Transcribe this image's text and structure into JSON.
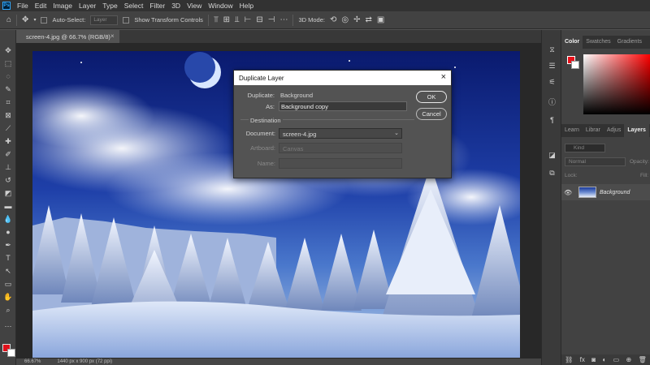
{
  "menubar": {
    "logo": "Ps",
    "items": [
      "File",
      "Edit",
      "Image",
      "Layer",
      "Type",
      "Select",
      "Filter",
      "3D",
      "View",
      "Window",
      "Help"
    ]
  },
  "options": {
    "auto_select": "Auto-Select:",
    "layer_field": "Layer",
    "transform_controls": "Show Transform Controls",
    "mode_3d": "3D Mode:"
  },
  "document": {
    "tab_title": "screen-4.jpg @ 66.7% (RGB/8)",
    "zoom": "66.67%",
    "status_info": "1440 px x 900 px (72 ppi)"
  },
  "panel": {
    "top_tabs": [
      "Color",
      "Swatches",
      "Gradients"
    ],
    "layer_tabs": [
      "Learn",
      "Librar",
      "Adjus",
      "Layers",
      "Ch"
    ],
    "search_placeholder": "Kind",
    "blend_mode": "Normal",
    "opacity_label": "Opacity:",
    "lock_label": "Lock:",
    "fill_label": "Fill:",
    "layer_name": "Background"
  },
  "dialog": {
    "title": "Duplicate Layer",
    "duplicate_label": "Duplicate:",
    "duplicate_value": "Background",
    "as_label": "As:",
    "as_value": "Background copy",
    "destination_label": "Destination",
    "document_label": "Document:",
    "document_value": "screen-4.jpg",
    "artboard_label": "Artboard:",
    "artboard_value": "Canvas",
    "name_label": "Name:",
    "ok_label": "OK",
    "cancel_label": "Cancel"
  },
  "colors": {
    "foreground": "#e8101a",
    "background": "#ffffff",
    "app_bg": "#535353"
  }
}
